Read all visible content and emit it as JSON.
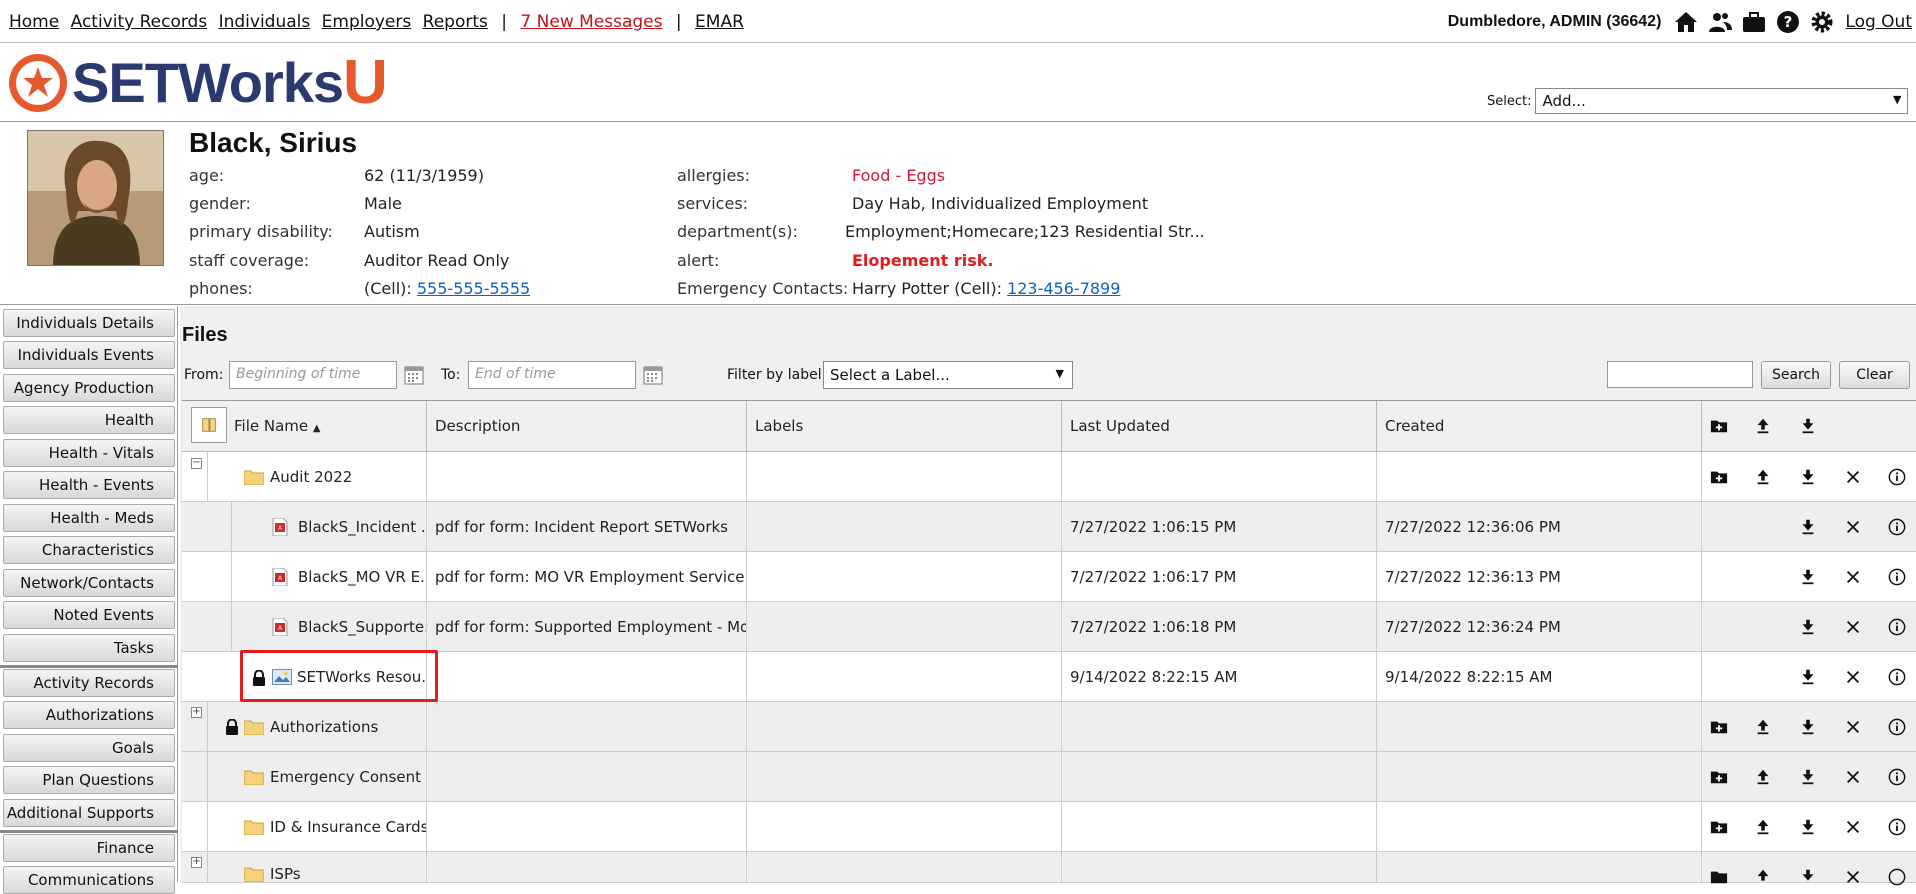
{
  "nav": {
    "links": [
      "Home",
      "Activity Records",
      "Individuals",
      "Employers",
      "Reports"
    ],
    "separator": "|",
    "messages": "7 New Messages",
    "emar": "EMAR"
  },
  "user": {
    "name": "Dumbledore, ADMIN  (36642)",
    "logout": "Log Out"
  },
  "brand": {
    "logo_text": "SETWorks",
    "logo_letter": "U",
    "select_label": "Select:",
    "select_value": "Add..."
  },
  "individual": {
    "name": "Black, Sirius",
    "left_fields": [
      {
        "label": "age:",
        "value": "62 (11/3/1959)"
      },
      {
        "label": "gender:",
        "value": "Male"
      },
      {
        "label": "primary disability:",
        "value": "Autism"
      },
      {
        "label": "staff coverage:",
        "value": "Auditor Read Only"
      },
      {
        "label": "phones:",
        "value": "(Cell): ",
        "link": "555-555-5555"
      }
    ],
    "right_fields": [
      {
        "label": "allergies:",
        "value": "Food - Eggs"
      },
      {
        "label": "services:",
        "value": "Day Hab, Individualized Employment"
      },
      {
        "label": "department(s):",
        "value": "Employment;Homecare;123 Residential Str..."
      },
      {
        "label": "alert:",
        "value": "Elopement risk."
      },
      {
        "label": "Emergency Contacts:",
        "value": "Harry Potter (Cell): ",
        "link": "123-456-7899"
      }
    ],
    "colors": {
      "allergy": "#d2183a",
      "alert": "#e01c1c"
    }
  },
  "sidebar": {
    "items": [
      "Individuals Details",
      "Individuals Events",
      "Agency Production",
      "Health",
      "Health - Vitals",
      "Health - Events",
      "Health - Meds",
      "Characteristics",
      "Network/Contacts",
      "Noted Events",
      "Tasks",
      "Activity Records",
      "Authorizations",
      "Goals",
      "Plan Questions",
      "Additional Supports",
      "Finance",
      "Communications"
    ]
  },
  "files": {
    "title": "Files",
    "from_label": "From:",
    "from_placeholder": "Beginning of time",
    "to_label": "To:",
    "to_placeholder": "End of time",
    "filter_label": "Filter by label:",
    "filter_value": "Select a Label...",
    "search_button": "Search",
    "clear_button": "Clear",
    "columns": [
      "File Name",
      "Description",
      "Labels",
      "Last Updated",
      "Created"
    ],
    "rows": [
      {
        "name": "Audit 2022",
        "description": "",
        "labels": "",
        "updated": "",
        "created": ""
      },
      {
        "name": "BlackS_Incident ...",
        "description": "pdf for form: Incident Report SETWorks",
        "labels": "",
        "updated": "7/27/2022 1:06:15 PM",
        "created": "7/27/2022 12:36:06 PM"
      },
      {
        "name": "BlackS_MO VR E...",
        "description": "pdf for form: MO VR Employment Service ...",
        "labels": "",
        "updated": "7/27/2022 1:06:17 PM",
        "created": "7/27/2022 12:36:13 PM"
      },
      {
        "name": "BlackS_Supporte...",
        "description": "pdf for form: Supported Employment - Mo...",
        "labels": "",
        "updated": "7/27/2022 1:06:18 PM",
        "created": "7/27/2022 12:36:24 PM"
      },
      {
        "name": "SETWorks Resou...",
        "description": "",
        "labels": "",
        "updated": "9/14/2022 8:22:15 AM",
        "created": "9/14/2022 8:22:15 AM"
      },
      {
        "name": "Authorizations",
        "description": "",
        "labels": "",
        "updated": "",
        "created": ""
      },
      {
        "name": "Emergency Consent ...",
        "description": "",
        "labels": "",
        "updated": "",
        "created": ""
      },
      {
        "name": "ID & Insurance Cards",
        "description": "",
        "labels": "",
        "updated": "",
        "created": ""
      },
      {
        "name": "ISPs",
        "description": "",
        "labels": "",
        "updated": "",
        "created": ""
      }
    ]
  }
}
